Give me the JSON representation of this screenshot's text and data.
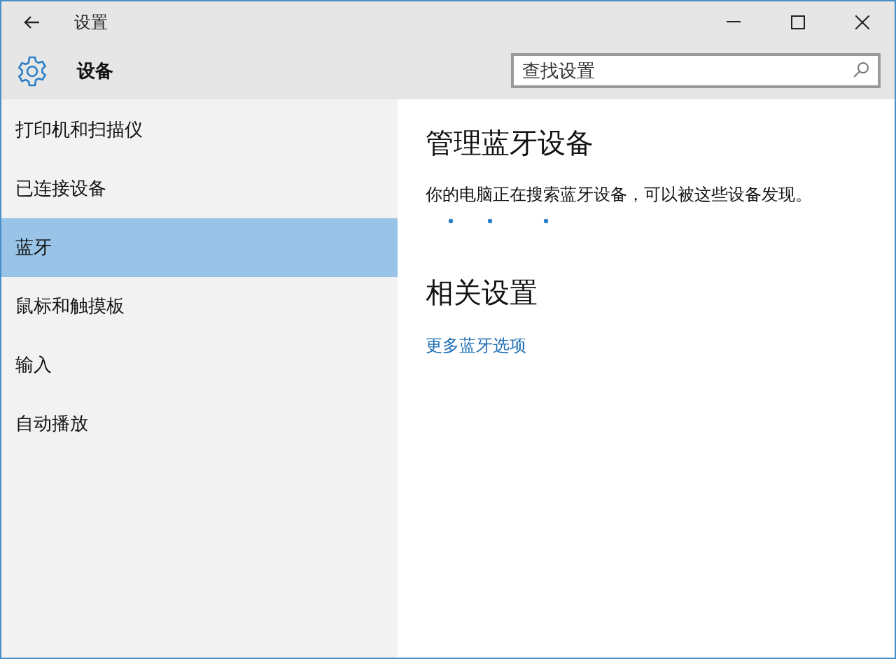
{
  "window": {
    "title": "设置"
  },
  "header": {
    "title": "设备",
    "search": {
      "placeholder": "查找设置"
    }
  },
  "sidebar": {
    "items": [
      {
        "label": "打印机和扫描仪",
        "selected": false
      },
      {
        "label": "已连接设备",
        "selected": false
      },
      {
        "label": "蓝牙",
        "selected": true
      },
      {
        "label": "鼠标和触摸板",
        "selected": false
      },
      {
        "label": "输入",
        "selected": false
      },
      {
        "label": "自动播放",
        "selected": false
      }
    ]
  },
  "content": {
    "heading": "管理蓝牙设备",
    "status": "你的电脑正在搜索蓝牙设备，可以被这些设备发现。",
    "related_heading": "相关设置",
    "link": "更多蓝牙选项"
  }
}
